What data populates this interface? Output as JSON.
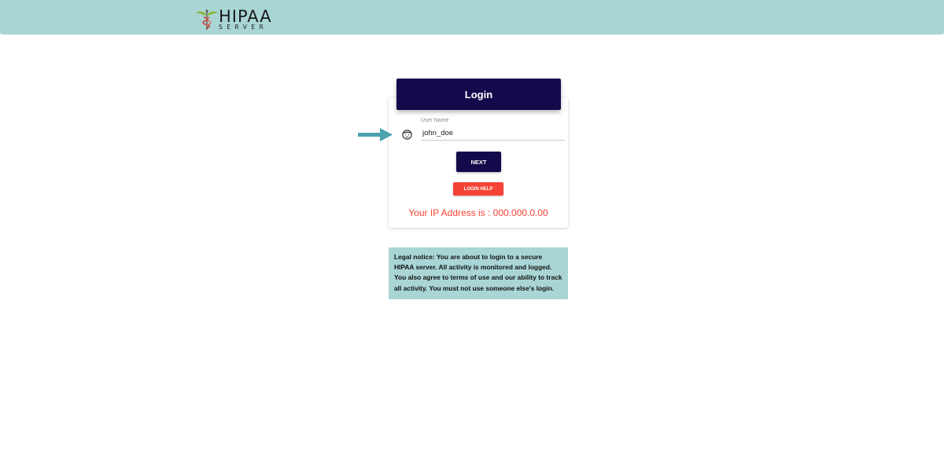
{
  "header": {
    "logo": {
      "icon": "caduceus-icon",
      "title": "HIPAA",
      "subtitle": "SERVER"
    },
    "background_color": "#a9d5d5"
  },
  "login": {
    "title": "Login",
    "username_label": "User Name",
    "username_value": "john_doe",
    "user_icon": "user-face-icon",
    "pointer_icon": "arrow-right-icon",
    "next_label": "NEXT",
    "help_label": "LOGIN HELP",
    "ip_text": "Your IP Address is : 000.000.0.00",
    "primary_color": "#120a4b",
    "danger_color": "#f44336"
  },
  "notice": {
    "text": "Legal notice: You are about to login to a secure HIPAA server. All activity is monitored and logged. You also agree to terms of use and our ability to track all activity. You must not use someone else's login."
  }
}
